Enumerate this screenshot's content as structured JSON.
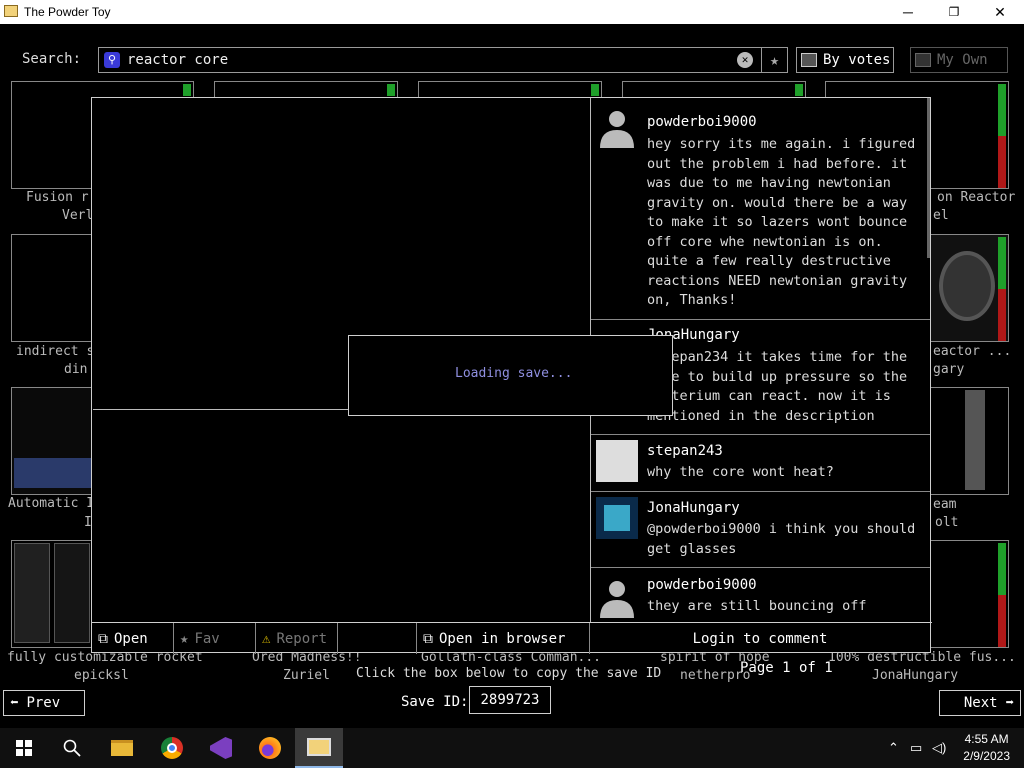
{
  "window": {
    "title": "The Powder Toy",
    "minimize": "─",
    "maximize": "❐",
    "close": "✕"
  },
  "search": {
    "label": "Search:",
    "value": "reactor core"
  },
  "top_buttons": {
    "by_votes": "By votes",
    "my_own": "My Own"
  },
  "thumb_labels": {
    "l1": "Fusion r",
    "l1b": "Verl",
    "l2": "indirect s",
    "l2b": "din",
    "l3": "Automatic I",
    "l3b": "I",
    "r1": "on Reactor",
    "r1b": "el",
    "r2": "eactor ...",
    "r2b": "gary",
    "r3": "eam",
    "r3b": "olt"
  },
  "bottom_row": [
    {
      "title": "fully customizable rocket",
      "author": "epicksl"
    },
    {
      "title": "Ored Madness!!",
      "author": "Zuriel"
    },
    {
      "title": "Gollath-class Comman...",
      "author": ""
    },
    {
      "title": "spirit of hope",
      "author": "netherpro"
    },
    {
      "title": "100% destructible fus...",
      "author": "JonaHungary"
    }
  ],
  "comments": [
    {
      "author": "powderboi9000",
      "text": "hey sorry its me again. i figured out the problem i had before. it was due to me having newtonian gravity on. would there be a way to make it so lazers wont bounce off core whe newtonian is on. quite a few really destructive reactions NEED newtonian gravity on, Thanks!"
    },
    {
      "author": "JonaHungary",
      "text": "@stepan234 it takes time for the core to build up pressure so the deuterium can react. now it is mentioned in the description"
    },
    {
      "author": "stepan243",
      "text": "why the core wont heat?"
    },
    {
      "author": "JonaHungary",
      "text": "@powderboi9000 i think you should get glasses"
    },
    {
      "author": "powderboi9000",
      "text": "they are still bouncing off"
    }
  ],
  "loading_text": "Loading save...",
  "modal_buttons": {
    "open": "Open",
    "fav": "Fav",
    "report": "Report",
    "open_browser": "Open in browser",
    "login": "Login to comment"
  },
  "bottom": {
    "copy_hint": "Click the box below to copy the save ID",
    "page": "Page 1 of 1",
    "save_id_label": "Save ID:",
    "save_id": "2899723",
    "prev": "Prev",
    "next": "Next"
  },
  "taskbar": {
    "time": "4:55 AM",
    "date": "2/9/2023"
  }
}
